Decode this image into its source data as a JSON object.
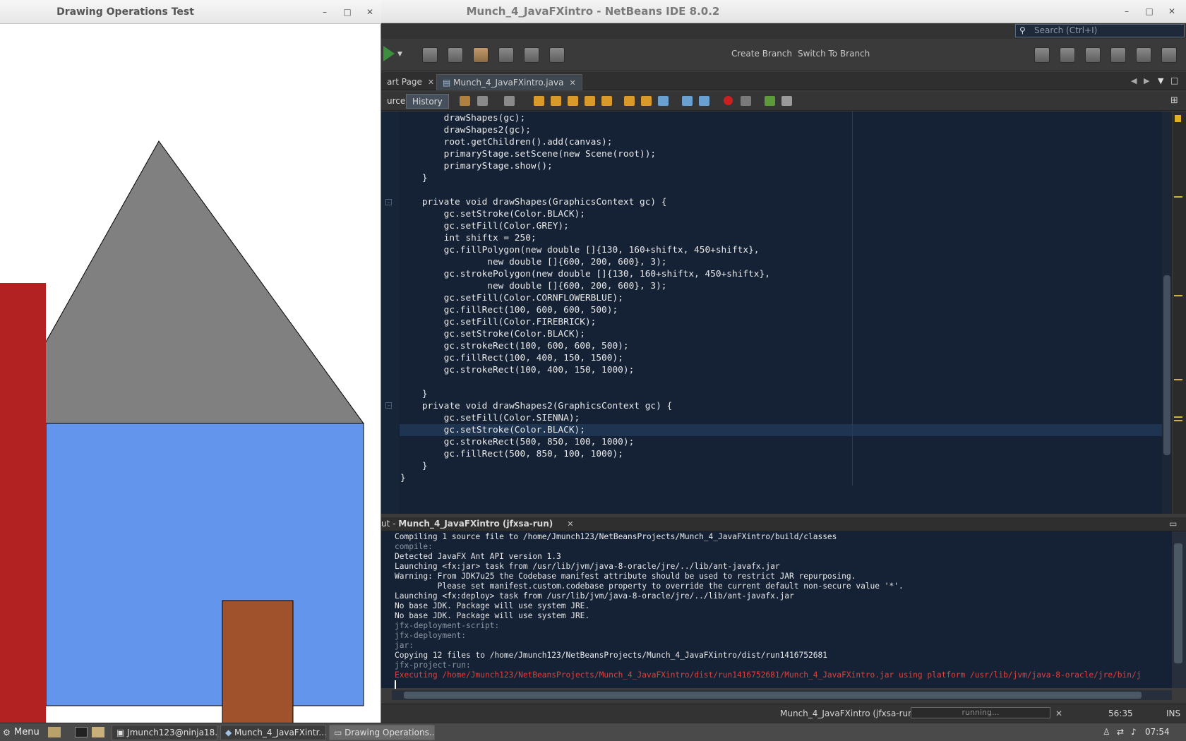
{
  "netbeans": {
    "title": "Munch_4_JavaFXintro - NetBeans IDE 8.0.2",
    "search_placeholder": "Search (Ctrl+I)",
    "toolbar": {
      "create_branch": "Create Branch",
      "switch_branch": "Switch To Branch"
    },
    "tabs": [
      {
        "label": "art Page"
      },
      {
        "label": "Munch_4_JavaFXintro.java"
      }
    ],
    "modes": {
      "source": "urce",
      "history": "History"
    },
    "code_lines": [
      "        drawShapes(gc);",
      "        drawShapes2(gc);",
      "        root.getChildren().add(canvas);",
      "        primaryStage.setScene(new Scene(root));",
      "        primaryStage.show();",
      "    }",
      "",
      "    private void drawShapes(GraphicsContext gc) {",
      "        gc.setStroke(Color.BLACK);",
      "        gc.setFill(Color.GREY);",
      "        int shiftx = 250;",
      "        gc.fillPolygon(new double []{130, 160+shiftx, 450+shiftx},",
      "                new double []{600, 200, 600}, 3);",
      "        gc.strokePolygon(new double []{130, 160+shiftx, 450+shiftx},",
      "                new double []{600, 200, 600}, 3);",
      "        gc.setFill(Color.CORNFLOWERBLUE);",
      "        gc.fillRect(100, 600, 600, 500);",
      "        gc.setFill(Color.FIREBRICK);",
      "        gc.setStroke(Color.BLACK);",
      "        gc.strokeRect(100, 600, 600, 500);",
      "        gc.fillRect(100, 400, 150, 1500);",
      "        gc.strokeRect(100, 400, 150, 1000);",
      "",
      "    }",
      "    private void drawShapes2(GraphicsContext gc) {",
      "        gc.setFill(Color.SIENNA);",
      "        gc.setStroke(Color.BLACK);",
      "        gc.strokeRect(500, 850, 100, 1000);",
      "        gc.fillRect(500, 850, 100, 1000);",
      "    }",
      "}"
    ],
    "output": {
      "title_prefix": "ut - ",
      "title": "Munch_4_JavaFXintro (jfxsa-run)",
      "lines": [
        {
          "text": "Compiling 1 source file to /home/Jmunch123/NetBeansProjects/Munch_4_JavaFXintro/build/classes",
          "style": "normal"
        },
        {
          "text": "compile:",
          "style": "gray"
        },
        {
          "text": "Detected JavaFX Ant API version 1.3",
          "style": "normal"
        },
        {
          "text": "Launching <fx:jar> task from /usr/lib/jvm/java-8-oracle/jre/../lib/ant-javafx.jar",
          "style": "normal"
        },
        {
          "text": "Warning: From JDK7u25 the Codebase manifest attribute should be used to restrict JAR repurposing.",
          "style": "normal"
        },
        {
          "text": "         Please set manifest.custom.codebase property to override the current default non-secure value '*'.",
          "style": "normal"
        },
        {
          "text": "Launching <fx:deploy> task from /usr/lib/jvm/java-8-oracle/jre/../lib/ant-javafx.jar",
          "style": "normal"
        },
        {
          "text": "No base JDK. Package will use system JRE.",
          "style": "normal"
        },
        {
          "text": "No base JDK. Package will use system JRE.",
          "style": "normal"
        },
        {
          "text": "jfx-deployment-script:",
          "style": "gray"
        },
        {
          "text": "jfx-deployment:",
          "style": "gray"
        },
        {
          "text": "jar:",
          "style": "gray"
        },
        {
          "text": "Copying 12 files to /home/Jmunch123/NetBeansProjects/Munch_4_JavaFXintro/dist/run1416752681",
          "style": "normal"
        },
        {
          "text": "jfx-project-run:",
          "style": "gray"
        },
        {
          "text": "Executing /home/Jmunch123/NetBeansProjects/Munch_4_JavaFXintro/dist/run1416752681/Munch_4_JavaFXintro.jar using platform /usr/lib/jvm/java-8-oracle/jre/bin/j",
          "style": "red"
        }
      ]
    },
    "status": {
      "task": "Munch_4_JavaFXintro (jfxsa-run)",
      "progress": "running...",
      "position": "56:35",
      "mode": "INS"
    }
  },
  "drawing_window": {
    "title": "Drawing Operations Test",
    "colors": {
      "grey": "#808080",
      "cornflowerblue": "#6495ed",
      "firebrick": "#b22222",
      "sienna": "#a0522d"
    }
  },
  "taskbar": {
    "menu": "Menu",
    "tasks": [
      {
        "label": "Jmunch123@ninja18..."
      },
      {
        "label": "Munch_4_JavaFXintr..."
      },
      {
        "label": "Drawing Operations..."
      }
    ],
    "clock": "07:54"
  }
}
